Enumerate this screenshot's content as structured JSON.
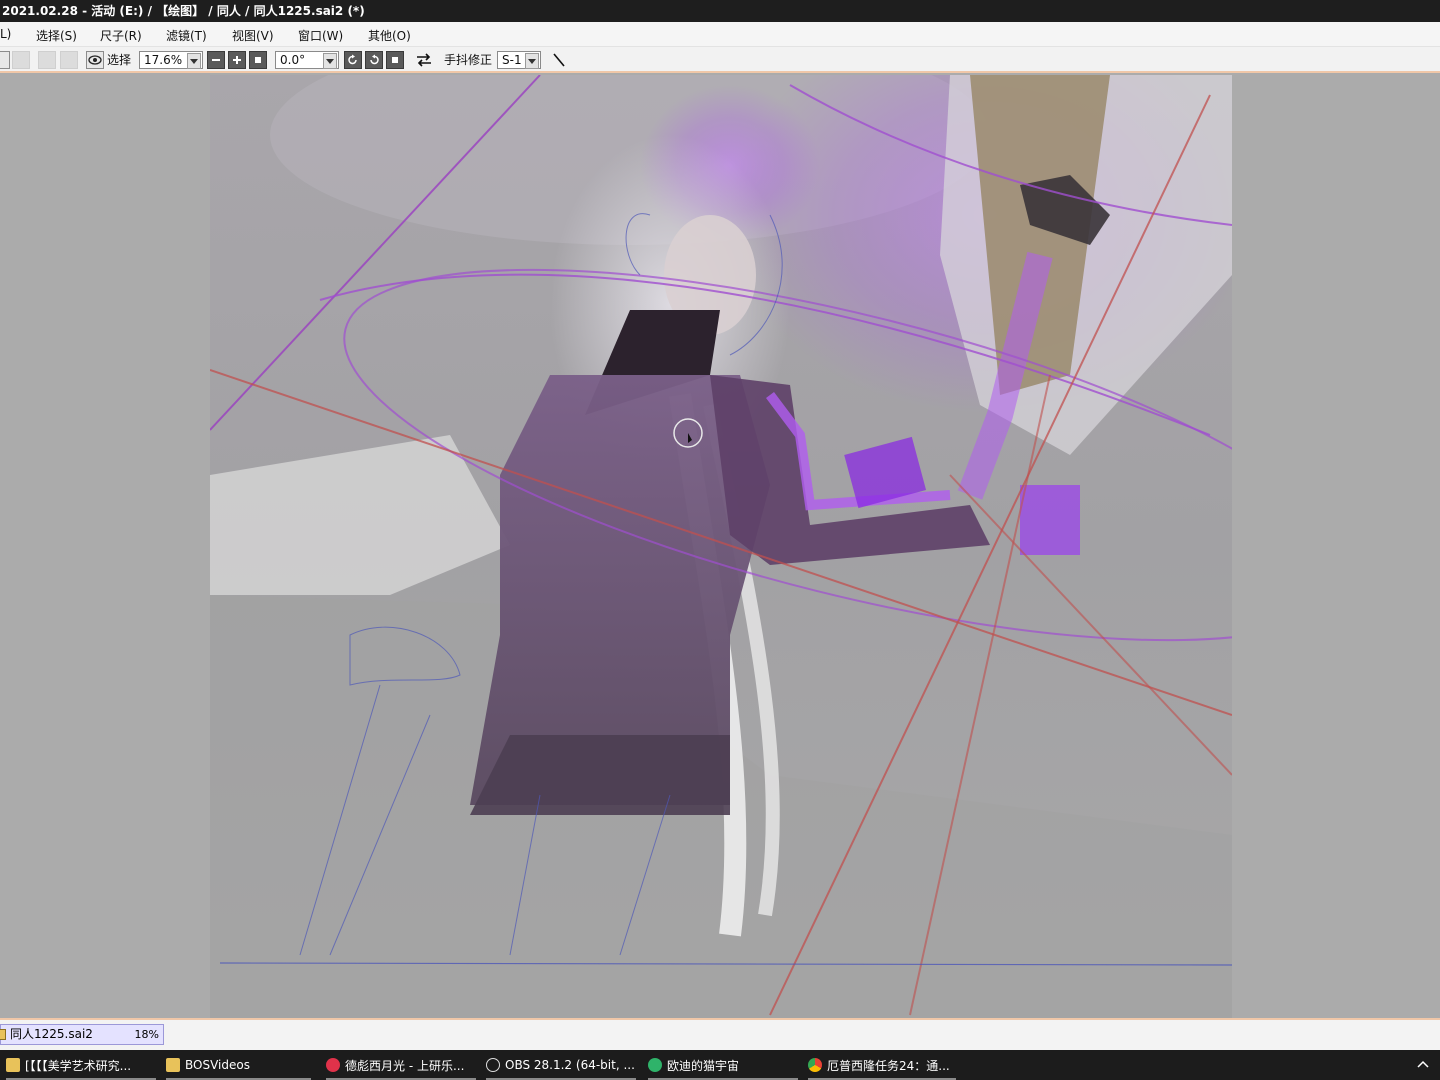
{
  "window": {
    "title": "2021.02.28 - 活动 (E:) / 【绘图】 / 同人 / 同人1225.sai2 (*)"
  },
  "menu": {
    "items": [
      "L)",
      "选择(S)",
      "尺子(R)",
      "滤镜(T)",
      "视图(V)",
      "窗口(W)",
      "其他(O)"
    ]
  },
  "toolbar": {
    "select_label": "选择",
    "zoom_value": "17.6%",
    "rotation_value": "0.0°",
    "stabilizer_label": "手抖修正",
    "stabilizer_value": "S-1"
  },
  "document_tab": {
    "name": "同人1225.sai2",
    "zoom": "18%"
  },
  "taskbar": {
    "items": [
      {
        "label": "[【【【美学艺术研究...",
        "icon": "folder-icon"
      },
      {
        "label": "BOSVideos",
        "icon": "folder-icon"
      },
      {
        "label": "德彪西月光 - 上研乐...",
        "icon": "music-icon"
      },
      {
        "label": "OBS 28.1.2 (64-bit, ...",
        "icon": "obs-icon"
      },
      {
        "label": "欧迪的猫宇宙",
        "icon": "chat-icon"
      },
      {
        "label": "厄普西隆任务24：通...",
        "icon": "chrome-icon"
      }
    ],
    "tray_icon": "chevron-up-icon"
  },
  "colors": {
    "title_bg": "#1e1e1e",
    "accent_border": "#f0c7a8",
    "doc_tab_bg": "#e4e2ff",
    "purple_glow": "#b05cf0"
  }
}
